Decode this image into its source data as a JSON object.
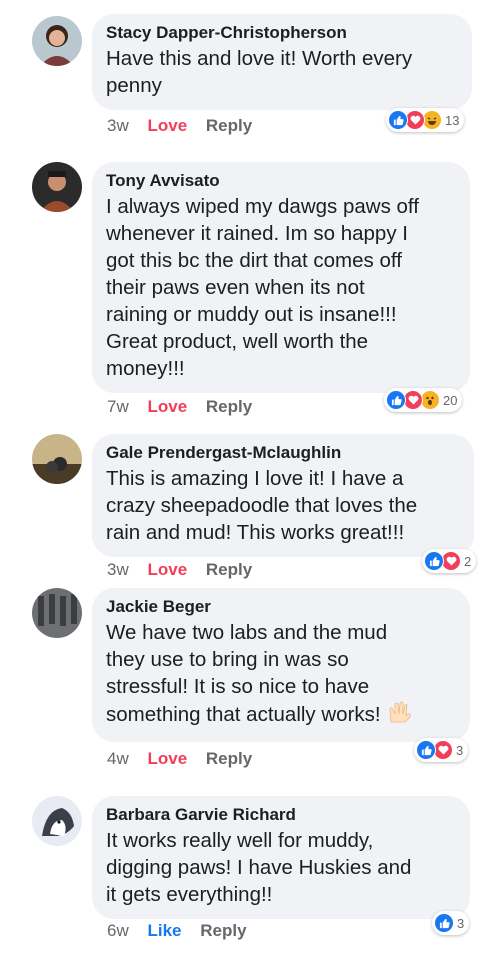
{
  "comments": [
    {
      "name": "Stacy Dapper-Christopherson",
      "text": "Have this and love it!  Worth every\npenny",
      "time": "3w",
      "reaction_label": "Love",
      "reply_label": "Reply",
      "reaction_count": "13",
      "reaction_icons": [
        "like-icon",
        "love-icon",
        "haha-icon"
      ]
    },
    {
      "name": "Tony Avvisato",
      "text": "I always wiped my dawgs paws off\nwhenever it rained. Im so happy I\ngot this bc the dirt that comes off\ntheir paws even when its not\nraining or muddy out is insane!!!\nGreat product, well worth the\nmoney!!!",
      "time": "7w",
      "reaction_label": "Love",
      "reply_label": "Reply",
      "reaction_count": "20",
      "reaction_icons": [
        "like-icon",
        "love-icon",
        "wow-icon"
      ]
    },
    {
      "name": "Gale Prendergast-Mclaughlin",
      "text": "This is amazing I love it!  I have a\ncrazy sheepadoodle that loves the\nrain and mud! This works great!!!",
      "time": "3w",
      "reaction_label": "Love",
      "reply_label": "Reply",
      "reaction_count": "2",
      "reaction_icons": [
        "like-icon",
        "love-icon"
      ]
    },
    {
      "name": "Jackie Beger",
      "text": "We have two labs and the mud\nthey use to bring in was so\nstressful! It is so nice to have\nsomething that actually works!",
      "time": "4w",
      "reaction_label": "Love",
      "reply_label": "Reply",
      "reaction_count": "3",
      "reaction_icons": [
        "like-icon",
        "love-icon"
      ],
      "trailing_emoji": "raised-hands-icon"
    },
    {
      "name": "Barbara Garvie Richard",
      "text": "It works really well for muddy,\ndigging paws!  I have Huskies and\nit gets everything!!",
      "time": "6w",
      "reaction_label": "Like",
      "reply_label": "Reply",
      "reaction_count": "3",
      "reaction_icons": [
        "like-icon"
      ]
    }
  ],
  "colors": {
    "like": "#1877f2",
    "love": "#f33e58",
    "bubble": "#f0f2f5"
  }
}
